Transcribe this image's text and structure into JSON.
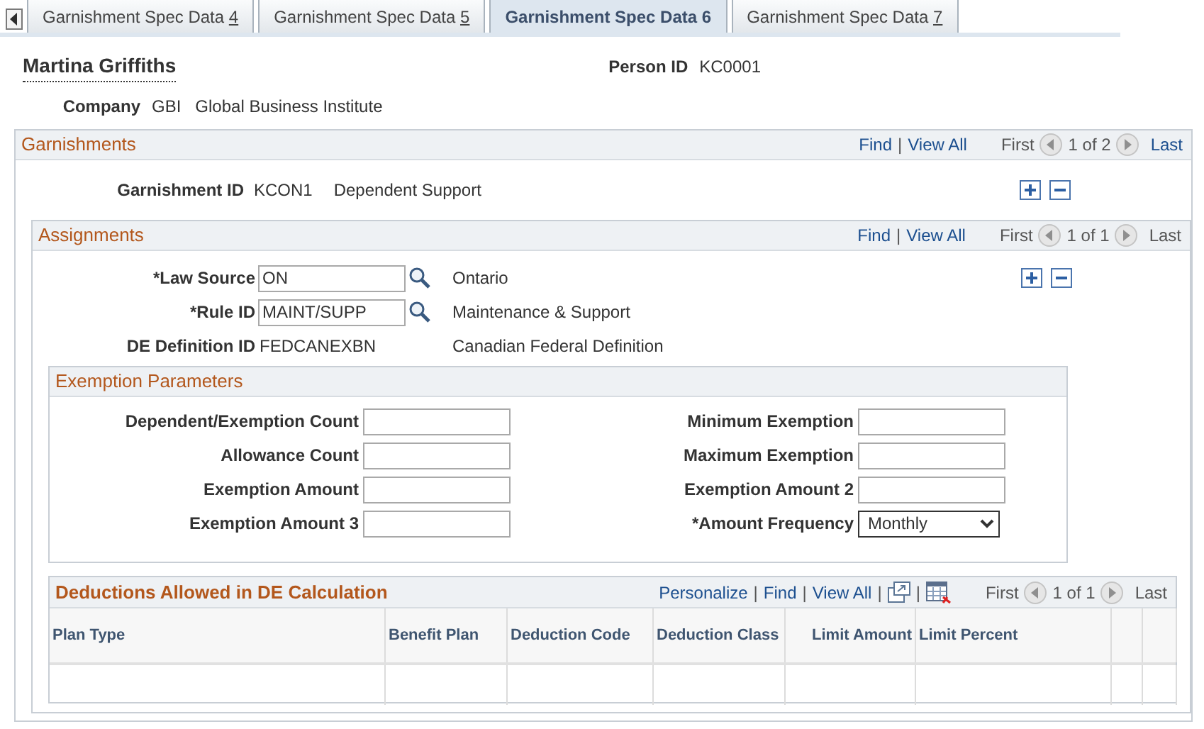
{
  "tabs": [
    {
      "label": "Garnishment Spec Data",
      "key": "4",
      "selected": false
    },
    {
      "label": "Garnishment Spec Data",
      "key": "5",
      "selected": false
    },
    {
      "label": "Garnishment Spec Data",
      "key": "6",
      "selected": true
    },
    {
      "label": "Garnishment Spec Data",
      "key": "7",
      "selected": false
    }
  ],
  "employee": {
    "name": "Martina Griffiths",
    "person_id_label": "Person ID",
    "person_id": "KC0001",
    "company_label": "Company",
    "company_code": "GBI",
    "company_name": "Global Business Institute"
  },
  "garnishments": {
    "title": "Garnishments",
    "nav": [
      {
        "kind": "link",
        "text": "Find"
      },
      {
        "kind": "sep",
        "text": "|"
      },
      {
        "kind": "link",
        "text": "View All"
      },
      {
        "kind": "end",
        "text": "First",
        "disabled": true
      },
      {
        "kind": "prev"
      },
      {
        "kind": "count",
        "text": "1 of 2"
      },
      {
        "kind": "next"
      },
      {
        "kind": "end",
        "text": "Last",
        "disabled": false
      }
    ],
    "field": {
      "label": "Garnishment ID",
      "value": "KCON1",
      "description": "Dependent Support"
    },
    "assignments": {
      "title": "Assignments",
      "nav": [
        {
          "kind": "link",
          "text": "Find"
        },
        {
          "kind": "sep",
          "text": "|"
        },
        {
          "kind": "link",
          "text": "View All"
        },
        {
          "kind": "end",
          "text": "First",
          "disabled": true
        },
        {
          "kind": "prev"
        },
        {
          "kind": "count",
          "text": "1 of 1"
        },
        {
          "kind": "next"
        },
        {
          "kind": "end",
          "text": "Last",
          "disabled": true
        }
      ],
      "fields": [
        {
          "kind": "lookup",
          "label": "*Law Source",
          "value": "ON",
          "description": "Ontario"
        },
        {
          "kind": "lookup",
          "label": "*Rule ID",
          "value": "MAINT/SUPP",
          "description": "Maintenance & Support"
        },
        {
          "kind": "display",
          "label": "DE Definition ID",
          "value": "FEDCANEXBN",
          "description": "Canadian Federal Definition"
        }
      ],
      "exemption_parameters": {
        "title": "Exemption Parameters",
        "left": [
          {
            "kind": "input",
            "label": "Dependent/Exemption Count"
          },
          {
            "kind": "input",
            "label": "Allowance Count"
          },
          {
            "kind": "input",
            "label": "Exemption Amount"
          },
          {
            "kind": "input",
            "label": "Exemption Amount 3"
          }
        ],
        "right": [
          {
            "kind": "input",
            "label": "Minimum Exemption"
          },
          {
            "kind": "input",
            "label": "Maximum Exemption"
          },
          {
            "kind": "input",
            "label": "Exemption Amount 2"
          },
          {
            "kind": "select",
            "label": "*Amount Frequency",
            "value": "Monthly"
          }
        ]
      },
      "deductions": {
        "title": "Deductions Allowed in DE Calculation",
        "nav": [
          {
            "kind": "link",
            "text": "Personalize"
          },
          {
            "kind": "sep",
            "text": "|"
          },
          {
            "kind": "link",
            "text": "Find"
          },
          {
            "kind": "sep",
            "text": "|"
          },
          {
            "kind": "link",
            "text": "View All"
          },
          {
            "kind": "sep",
            "text": "|"
          },
          {
            "kind": "popout"
          },
          {
            "kind": "sep",
            "text": "|"
          },
          {
            "kind": "download"
          },
          {
            "kind": "end",
            "text": "First",
            "disabled": true
          },
          {
            "kind": "prev"
          },
          {
            "kind": "count",
            "text": "1 of 1"
          },
          {
            "kind": "next"
          },
          {
            "kind": "end",
            "text": "Last",
            "disabled": true
          }
        ],
        "columns": [
          "Plan Type",
          "Benefit Plan",
          "Deduction Code",
          "Deduction Class",
          "Limit Amount",
          "Limit Percent"
        ]
      }
    }
  }
}
